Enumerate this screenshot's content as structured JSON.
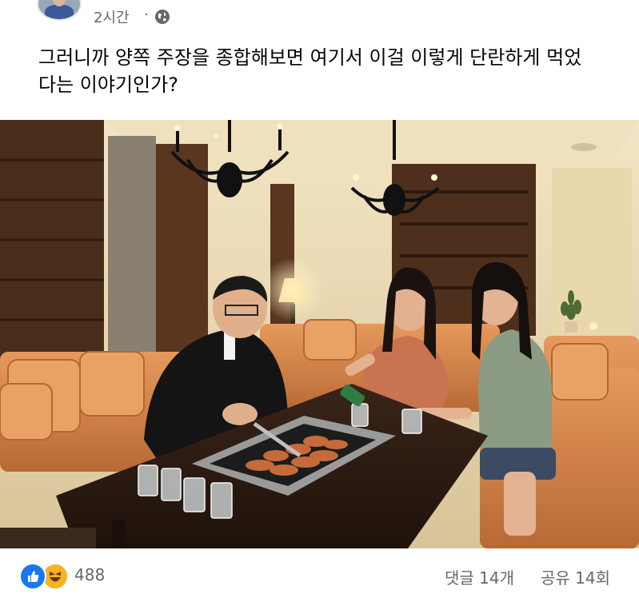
{
  "post": {
    "time": "2시간",
    "separator": "·",
    "audience_icon": "globe-icon",
    "text": "그러니까 양쪽 주장을 종합해보면 여기서 이걸 이렇게 단란하게 먹었다는 이야기인가?"
  },
  "photo": {
    "icons": [
      "chandelier",
      "floor-lamp",
      "potted-plant",
      "grill",
      "soju-bottle",
      "shot-glasses"
    ]
  },
  "footer": {
    "reaction_icons": [
      "like-icon",
      "haha-icon"
    ],
    "reaction_count": "488",
    "comments": "댓글 14개",
    "shares": "공유 14회"
  },
  "colors": {
    "accent": "#1877f2",
    "secondary_text": "#65676b",
    "sofa": "#d98a4e",
    "wood": "#5a3520",
    "wall": "#efe0b8"
  }
}
